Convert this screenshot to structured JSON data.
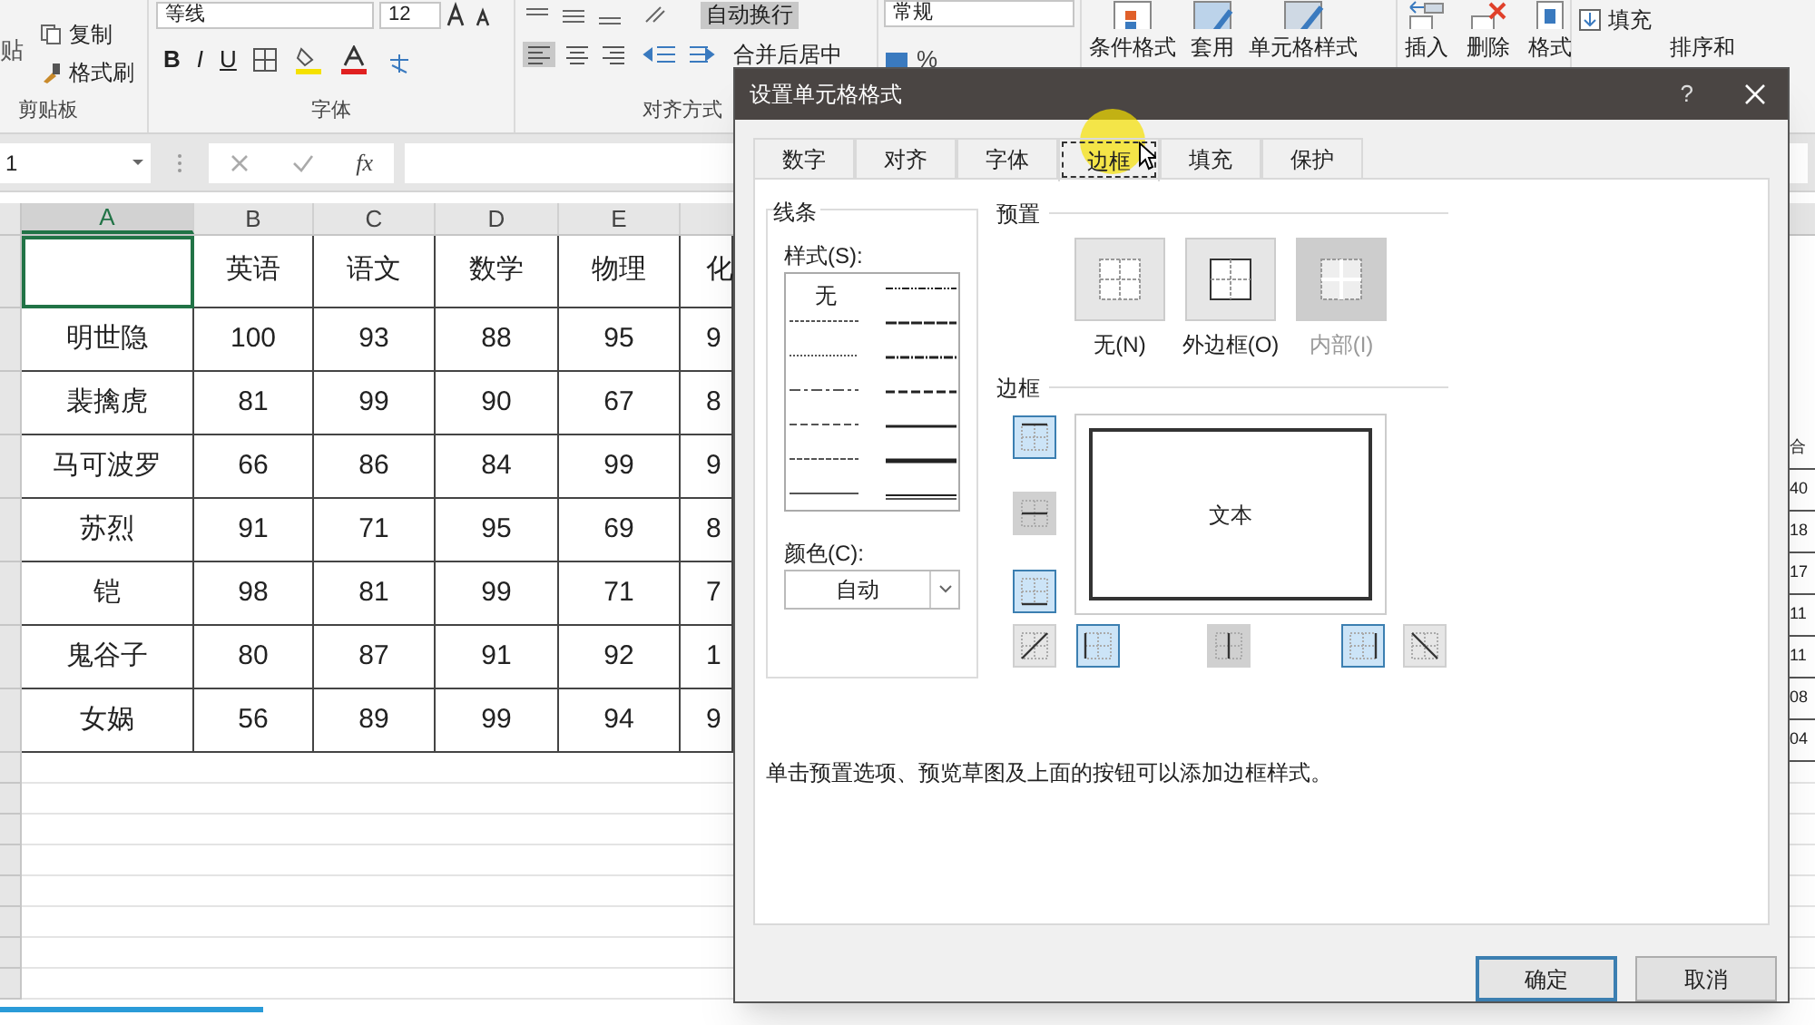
{
  "ribbon": {
    "clipboard": {
      "paste": "贴",
      "copy": "复制",
      "format_painter": "格式刷",
      "label": "剪贴板"
    },
    "font": {
      "name": "等线",
      "size": "12",
      "bold": "B",
      "italic": "I",
      "underline": "U",
      "label": "字体"
    },
    "alignment": {
      "wrap_text": {
        "label": "自动换行",
        "selected": true
      },
      "merge_center": "合并后居中",
      "label": "对齐方式"
    },
    "number": {
      "format": "常规",
      "percent": "%"
    },
    "styles": [
      "条件格式",
      "套用",
      "单元格样式"
    ],
    "cells": [
      "插入",
      "删除",
      "格式"
    ],
    "editing": {
      "fill": "填充",
      "sort": "排序和"
    }
  },
  "formula_bar": {
    "name_box": "1",
    "function_label": "fx"
  },
  "sheet": {
    "columns": [
      {
        "label": "A",
        "selected": true
      },
      {
        "label": "B",
        "selected": false
      },
      {
        "label": "C",
        "selected": false
      },
      {
        "label": "D",
        "selected": false
      },
      {
        "label": "E",
        "selected": false
      }
    ],
    "rows": [
      [
        "",
        "英语",
        "语文",
        "数学",
        "物理",
        "化"
      ],
      [
        "明世隐",
        "100",
        "93",
        "88",
        "95",
        "9"
      ],
      [
        "裴擒虎",
        "81",
        "99",
        "90",
        "67",
        "8"
      ],
      [
        "马可波罗",
        "66",
        "86",
        "84",
        "99",
        "9"
      ],
      [
        "苏烈",
        "91",
        "71",
        "95",
        "69",
        "8"
      ],
      [
        "铠",
        "98",
        "81",
        "99",
        "71",
        "7"
      ],
      [
        "鬼谷子",
        "80",
        "87",
        "91",
        "92",
        "1"
      ],
      [
        "女娲",
        "56",
        "89",
        "99",
        "94",
        "9"
      ]
    ]
  },
  "side_sheet": {
    "cells": [
      "合",
      "40",
      "18",
      "17",
      "11",
      "11",
      "08",
      "04"
    ]
  },
  "dialog": {
    "title": "设置单元格格式",
    "help": "?",
    "tabs": [
      {
        "label": "数字",
        "selected": false
      },
      {
        "label": "对齐",
        "selected": false
      },
      {
        "label": "字体",
        "selected": false
      },
      {
        "label": "边框",
        "selected": true
      },
      {
        "label": "填充",
        "selected": false
      },
      {
        "label": "保护",
        "selected": false
      }
    ],
    "line": {
      "legend": "线条",
      "style_label": "样式(S):",
      "none_label": "无",
      "color_label": "颜色(C):",
      "color_value": "自动"
    },
    "presets": {
      "legend": "预置",
      "items": [
        {
          "kind": "none",
          "label": "无(N)",
          "disabled": false
        },
        {
          "kind": "outline",
          "label": "外边框(O)",
          "disabled": false
        },
        {
          "kind": "inside",
          "label": "内部(I)",
          "disabled": true
        }
      ]
    },
    "border": {
      "legend": "边框",
      "preview_text": "文本",
      "buttons": [
        {
          "kind": "top",
          "selected": true,
          "disabled": false
        },
        {
          "kind": "middle_h",
          "selected": false,
          "disabled": true
        },
        {
          "kind": "bottom",
          "selected": true,
          "disabled": false
        },
        {
          "kind": "diag_up",
          "selected": false,
          "disabled": false
        },
        {
          "kind": "left",
          "selected": true,
          "disabled": false
        },
        {
          "kind": "middle_v",
          "selected": false,
          "disabled": true
        },
        {
          "kind": "right",
          "selected": true,
          "disabled": false
        },
        {
          "kind": "diag_down",
          "selected": false,
          "disabled": false
        }
      ]
    },
    "hint": "单击预置选项、预览草图及上面的按钮可以添加边框样式。",
    "buttons": [
      {
        "label": "确定",
        "default": true
      },
      {
        "label": "取消",
        "default": false
      }
    ]
  }
}
